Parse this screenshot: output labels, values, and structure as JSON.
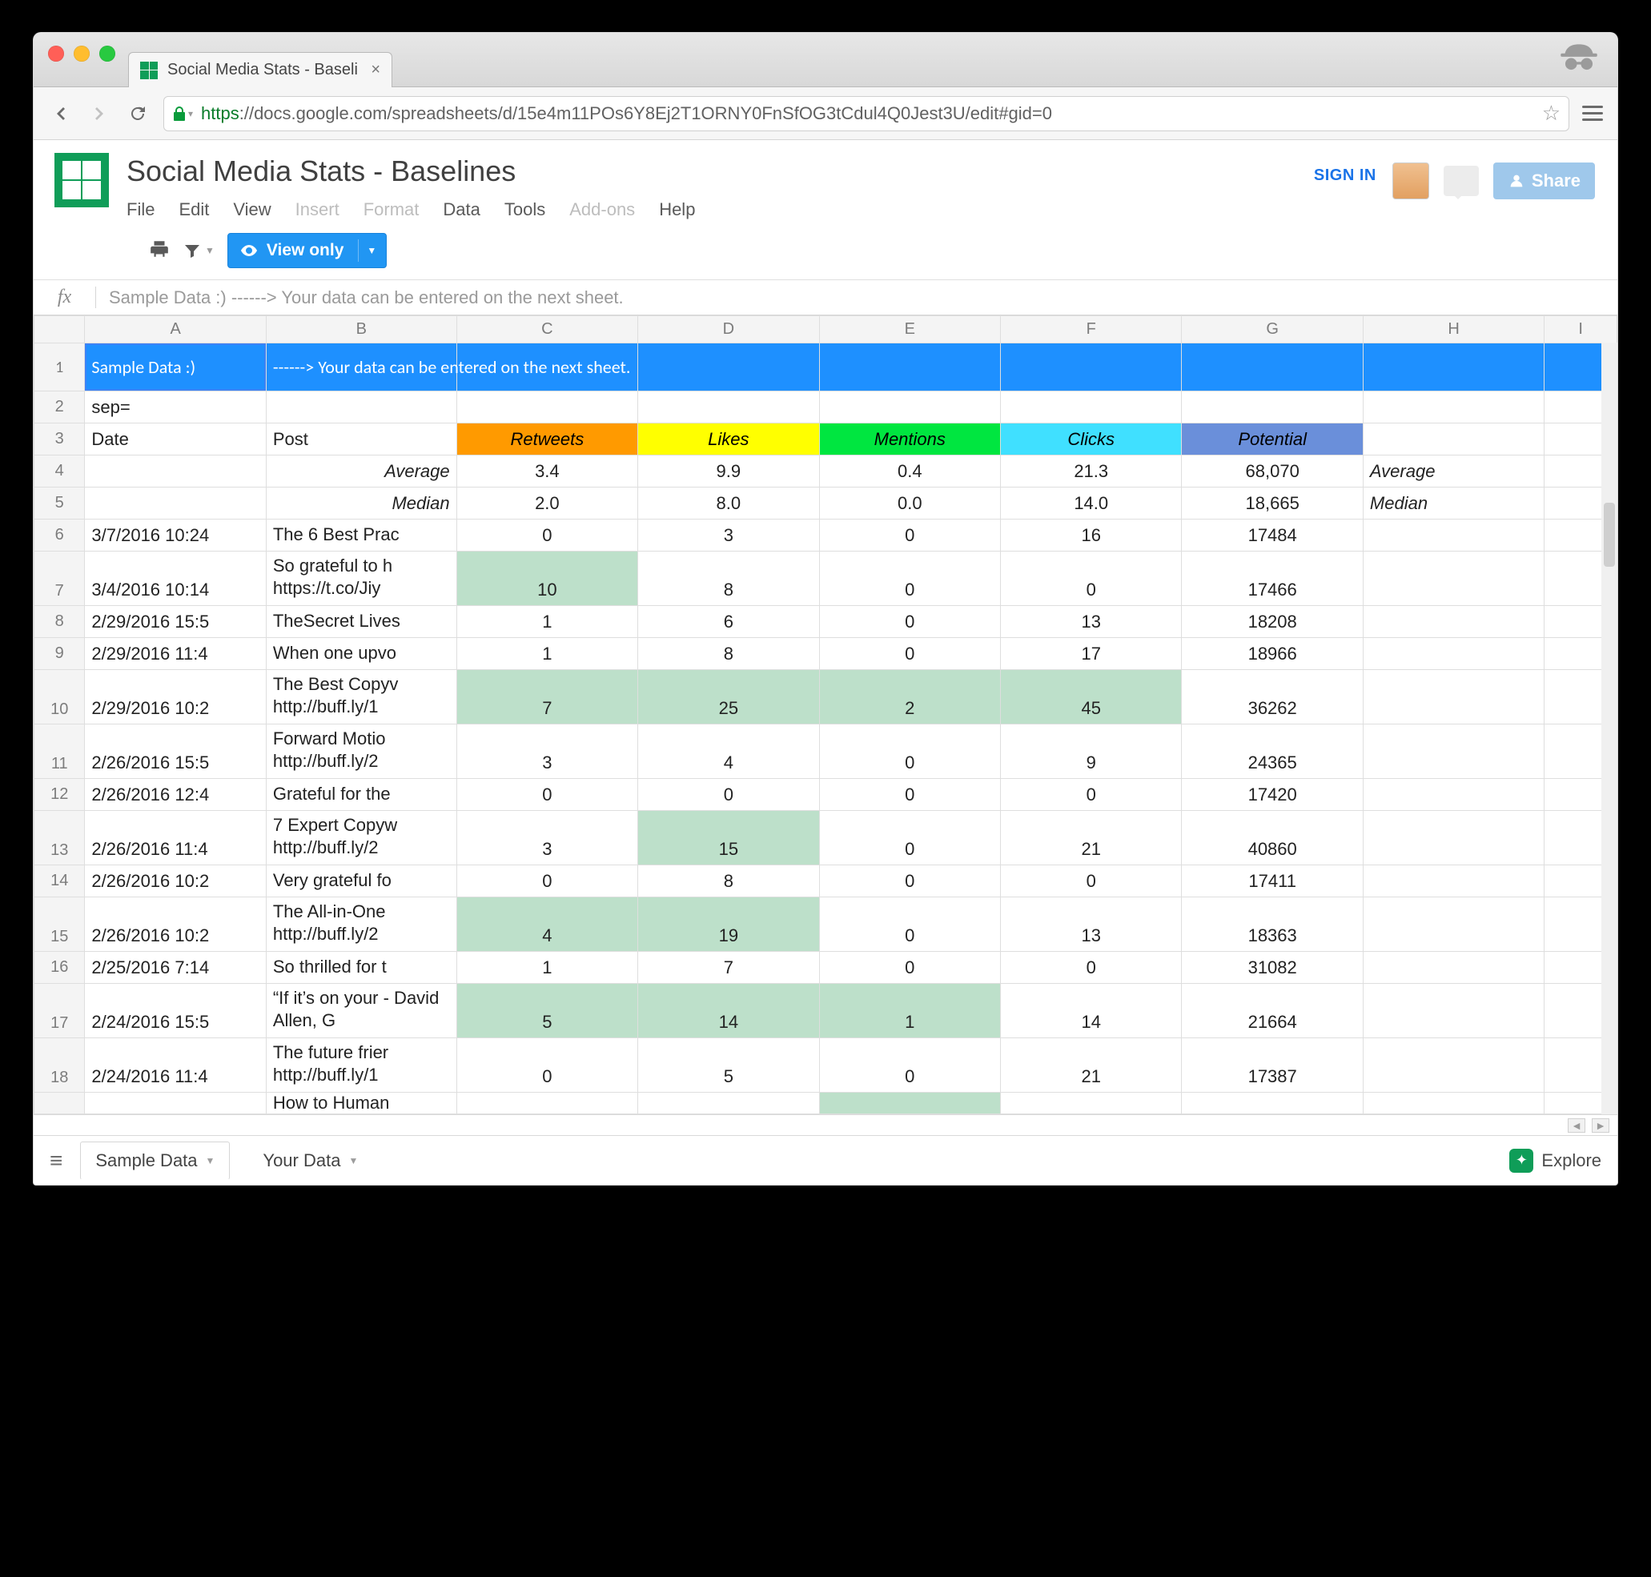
{
  "browser": {
    "tab_title": "Social Media Stats - Baseli",
    "url_scheme": "https",
    "url_rest": "://docs.google.com/spreadsheets/d/15e4m11POs6Y8Ej2T1ORNY0FnSfOG3tCdul4Q0Jest3U/edit#gid=0"
  },
  "header": {
    "doc_title": "Social Media Stats - Baselines",
    "menus": {
      "file": "File",
      "edit": "Edit",
      "view": "View",
      "insert": "Insert",
      "format": "Format",
      "data": "Data",
      "tools": "Tools",
      "addons": "Add-ons",
      "help": "Help"
    },
    "sign_in": "SIGN IN",
    "share": "Share",
    "view_only": "View only"
  },
  "formula_bar": {
    "fx": "fx",
    "content": "Sample Data :)  ------> Your data can be entered on the next sheet."
  },
  "columns": [
    "A",
    "B",
    "C",
    "D",
    "E",
    "F",
    "G",
    "H",
    "I"
  ],
  "banner": {
    "a": "Sample Data :)",
    "rest": "------> Your data can be entered on the next sheet."
  },
  "row2": {
    "a": "sep="
  },
  "headers": {
    "date": "Date",
    "post": "Post",
    "retweets": "Retweets",
    "likes": "Likes",
    "mentions": "Mentions",
    "clicks": "Clicks",
    "potential": "Potential"
  },
  "summary": {
    "avg_label": "Average",
    "avg": {
      "retweets": "3.4",
      "likes": "9.9",
      "mentions": "0.4",
      "clicks": "21.3",
      "potential": "68,070"
    },
    "med_label": "Median",
    "med": {
      "retweets": "2.0",
      "likes": "8.0",
      "mentions": "0.0",
      "clicks": "14.0",
      "potential": "18,665"
    }
  },
  "rows": [
    {
      "n": "6",
      "tall": false,
      "date": "3/7/2016 10:24",
      "post": "The 6 Best Prac",
      "rt": "0",
      "lk": "3",
      "mn": "0",
      "ck": "16",
      "pt": "17484",
      "hl": {}
    },
    {
      "n": "7",
      "tall": true,
      "date": "3/4/2016 10:14",
      "post": "So grateful to h https://t.co/Jiy",
      "rt": "10",
      "lk": "8",
      "mn": "0",
      "ck": "0",
      "pt": "17466",
      "hl": {
        "rt": true
      }
    },
    {
      "n": "8",
      "tall": false,
      "date": "2/29/2016 15:5",
      "post": "TheSecret Lives",
      "rt": "1",
      "lk": "6",
      "mn": "0",
      "ck": "13",
      "pt": "18208",
      "hl": {}
    },
    {
      "n": "9",
      "tall": false,
      "date": "2/29/2016 11:4",
      "post": "When one upvo",
      "rt": "1",
      "lk": "8",
      "mn": "0",
      "ck": "17",
      "pt": "18966",
      "hl": {}
    },
    {
      "n": "10",
      "tall": true,
      "date": "2/29/2016 10:2",
      "post": "The Best Copyv http://buff.ly/1",
      "rt": "7",
      "lk": "25",
      "mn": "2",
      "ck": "45",
      "pt": "36262",
      "hl": {
        "rt": true,
        "lk": true,
        "mn": true,
        "ck": true
      }
    },
    {
      "n": "11",
      "tall": true,
      "date": "2/26/2016 15:5",
      "post": "Forward Motio http://buff.ly/2",
      "rt": "3",
      "lk": "4",
      "mn": "0",
      "ck": "9",
      "pt": "24365",
      "hl": {}
    },
    {
      "n": "12",
      "tall": false,
      "date": "2/26/2016 12:4",
      "post": "Grateful for the",
      "rt": "0",
      "lk": "0",
      "mn": "0",
      "ck": "0",
      "pt": "17420",
      "hl": {}
    },
    {
      "n": "13",
      "tall": true,
      "date": "2/26/2016 11:4",
      "post": "7 Expert Copyw http://buff.ly/2",
      "rt": "3",
      "lk": "15",
      "mn": "0",
      "ck": "21",
      "pt": "40860",
      "hl": {
        "lk": true
      }
    },
    {
      "n": "14",
      "tall": false,
      "date": "2/26/2016 10:2",
      "post": "Very grateful fo",
      "rt": "0",
      "lk": "8",
      "mn": "0",
      "ck": "0",
      "pt": "17411",
      "hl": {}
    },
    {
      "n": "15",
      "tall": true,
      "date": "2/26/2016 10:2",
      "post": "The All-in-One  http://buff.ly/2",
      "rt": "4",
      "lk": "19",
      "mn": "0",
      "ck": "13",
      "pt": "18363",
      "hl": {
        "rt": true,
        "lk": true
      }
    },
    {
      "n": "16",
      "tall": false,
      "date": "2/25/2016 7:14",
      "post": "So thrilled for t",
      "rt": "1",
      "lk": "7",
      "mn": "0",
      "ck": "0",
      "pt": "31082",
      "hl": {}
    },
    {
      "n": "17",
      "tall": true,
      "date": "2/24/2016 15:5",
      "post": "“If it’s on your  - David Allen, G",
      "rt": "5",
      "lk": "14",
      "mn": "1",
      "ck": "14",
      "pt": "21664",
      "hl": {
        "rt": true,
        "lk": true,
        "mn": true
      }
    },
    {
      "n": "18",
      "tall": true,
      "date": "2/24/2016 11:4",
      "post": "The future frier http://buff.ly/1",
      "rt": "0",
      "lk": "5",
      "mn": "0",
      "ck": "21",
      "pt": "17387",
      "hl": {}
    }
  ],
  "partial_row": {
    "post": "How to Human",
    "hl_mn": true
  },
  "footer": {
    "tabs": {
      "sample": "Sample Data",
      "your": "Your Data"
    },
    "explore": "Explore"
  }
}
